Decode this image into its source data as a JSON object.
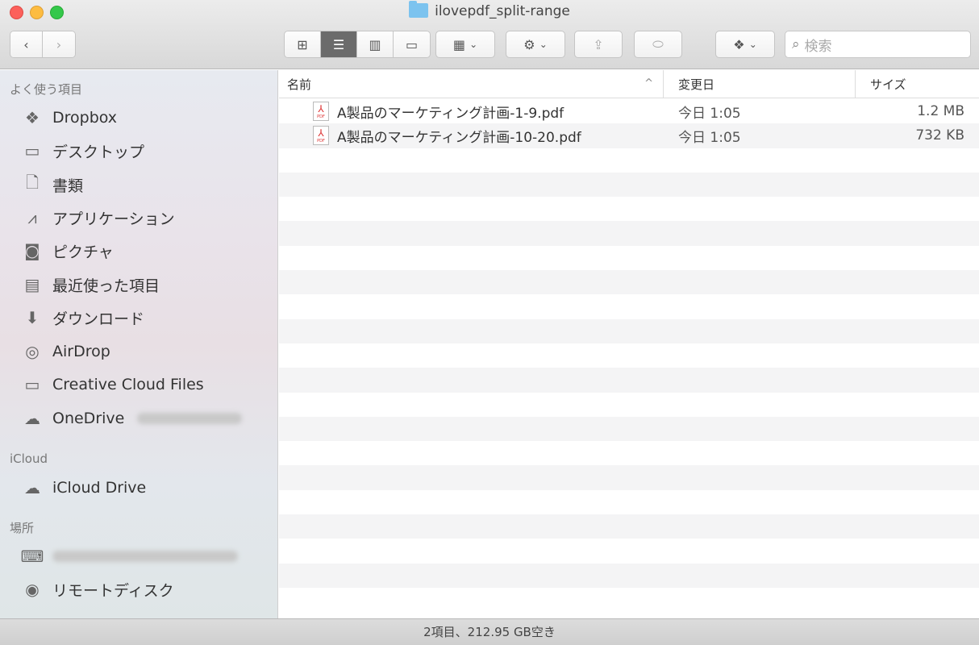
{
  "window": {
    "title": "ilovepdf_split-range"
  },
  "toolbar": {
    "back_icon": "chevron-left-icon",
    "forward_icon": "chevron-right-icon",
    "search_placeholder": "検索"
  },
  "sidebar": {
    "favorites_label": "よく使う項目",
    "favorites": [
      {
        "label": "Dropbox",
        "icon": "dropbox-icon"
      },
      {
        "label": "デスクトップ",
        "icon": "desktop-icon"
      },
      {
        "label": "書類",
        "icon": "documents-icon"
      },
      {
        "label": "アプリケーション",
        "icon": "applications-icon"
      },
      {
        "label": "ピクチャ",
        "icon": "camera-icon"
      },
      {
        "label": "最近使った項目",
        "icon": "recents-icon"
      },
      {
        "label": "ダウンロード",
        "icon": "download-icon"
      },
      {
        "label": "AirDrop",
        "icon": "airdrop-icon"
      },
      {
        "label": "Creative Cloud Files",
        "icon": "folder-icon"
      },
      {
        "label": "OneDrive",
        "icon": "cloud-icon"
      }
    ],
    "icloud_label": "iCloud",
    "icloud": [
      {
        "label": "iCloud Drive",
        "icon": "cloud-icon"
      }
    ],
    "locations_label": "場所",
    "locations": [
      {
        "label": "",
        "icon": "laptop-icon"
      },
      {
        "label": "リモートディスク",
        "icon": "disc-icon"
      }
    ]
  },
  "list": {
    "columns": {
      "name": "名前",
      "date": "変更日",
      "size": "サイズ"
    },
    "files": [
      {
        "name": "A製品のマーケティング計画-1-9.pdf",
        "date": "今日 1:05",
        "size": "1.2 MB"
      },
      {
        "name": "A製品のマーケティング計画-10-20.pdf",
        "date": "今日 1:05",
        "size": "732 KB"
      }
    ]
  },
  "status": {
    "text": "2項目、212.95 GB空き"
  }
}
